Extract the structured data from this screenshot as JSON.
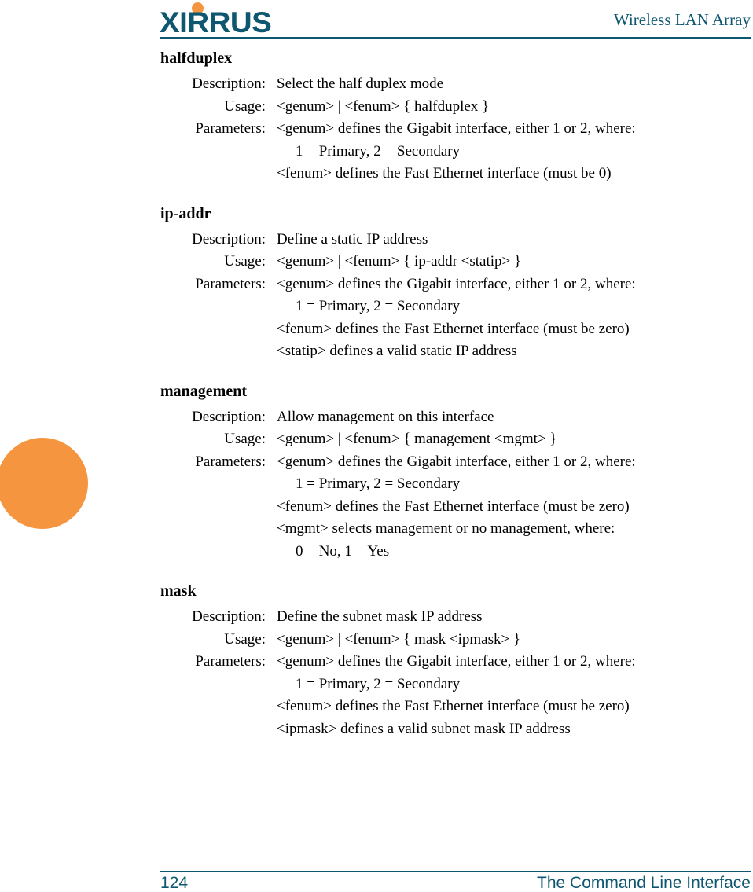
{
  "header": {
    "logo_text": "XIRRUS",
    "logo_dot": "orange-dot",
    "title": "Wireless LAN Array",
    "logo_color": "#0F5670",
    "dot_color": "#F5953F"
  },
  "marker": {
    "name": "orange-thumb-circle",
    "color": "#F5953F"
  },
  "labels": {
    "description": "Description:",
    "usage": "Usage:",
    "parameters": "Parameters:"
  },
  "commands": [
    {
      "name": "halfduplex",
      "description": "Select the half duplex mode",
      "usage": "<genum> | <fenum> { halfduplex }",
      "parameters": [
        "<genum> defines the Gigabit interface, either 1 or 2, where:",
        "1 = Primary, 2 = Secondary",
        "<fenum> defines the Fast Ethernet interface (must be 0)"
      ],
      "indented": [
        false,
        true,
        false
      ]
    },
    {
      "name": "ip-addr",
      "description": "Define a static IP address",
      "usage": "<genum> | <fenum> { ip-addr <statip> }",
      "parameters": [
        "<genum> defines the Gigabit interface, either 1 or 2, where:",
        "1 = Primary, 2 = Secondary",
        "<fenum> defines the Fast Ethernet interface (must be zero)",
        "<statip> defines a valid static IP address"
      ],
      "indented": [
        false,
        true,
        false,
        false
      ]
    },
    {
      "name": "management",
      "description": "Allow management on this interface",
      "usage": "<genum> | <fenum> { management <mgmt> }",
      "parameters": [
        "<genum> defines the Gigabit interface, either 1 or 2, where:",
        "1 = Primary, 2 = Secondary",
        "<fenum> defines the Fast Ethernet interface (must be zero)",
        "<mgmt> selects management or no management, where:",
        "0 = No, 1 = Yes"
      ],
      "indented": [
        false,
        true,
        false,
        false,
        true
      ]
    },
    {
      "name": "mask",
      "description": "Define the subnet mask IP address",
      "usage": "<genum> | <fenum> { mask <ipmask> }",
      "parameters": [
        "<genum> defines the Gigabit interface, either 1 or 2, where:",
        "1 = Primary, 2 = Secondary",
        "<fenum> defines the Fast Ethernet interface (must be zero)",
        "<ipmask> defines a valid subnet mask IP address"
      ],
      "indented": [
        false,
        true,
        false,
        false
      ]
    }
  ],
  "footer": {
    "page_number": "124",
    "section_title": "The Command Line Interface",
    "color": "#0F5670"
  }
}
